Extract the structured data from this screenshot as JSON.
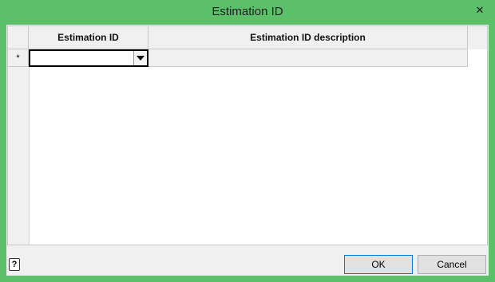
{
  "window": {
    "title": "Estimation ID",
    "close_glyph": "✕"
  },
  "grid": {
    "columns": [
      "Estimation ID",
      "Estimation ID description"
    ],
    "new_row_marker": "*",
    "rows": [
      {
        "estimation_id": "",
        "description": ""
      }
    ]
  },
  "footer": {
    "help_glyph": "?",
    "ok_label": "OK",
    "cancel_label": "Cancel"
  },
  "colors": {
    "titlebar": "#5cbf6a",
    "client": "#f0f0f0",
    "focus_border": "#000000"
  }
}
